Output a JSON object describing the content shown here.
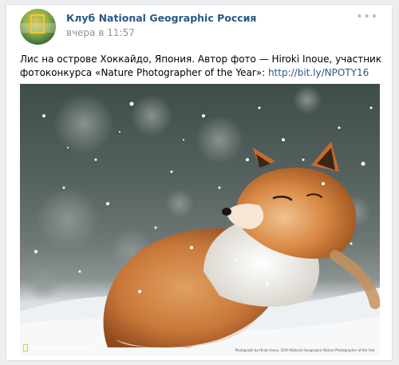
{
  "post": {
    "author": "Клуб National Geographic Россия",
    "time": "вчера в 11:57",
    "more_glyph": "•••",
    "text": "Лис на острове Хоккайдо, Япония. Автор фото — Hiroki Inoue, участник фотоконкурса «Nature Photographer of the Year»: ",
    "link": "http://bit.ly/NPOTY16"
  },
  "photo": {
    "watermark": "NATIONAL GEOGRAPHIC",
    "credit": "Photograph by Hiroki Inoue, 2016 National Geographic Nature Photographer of the Year"
  }
}
